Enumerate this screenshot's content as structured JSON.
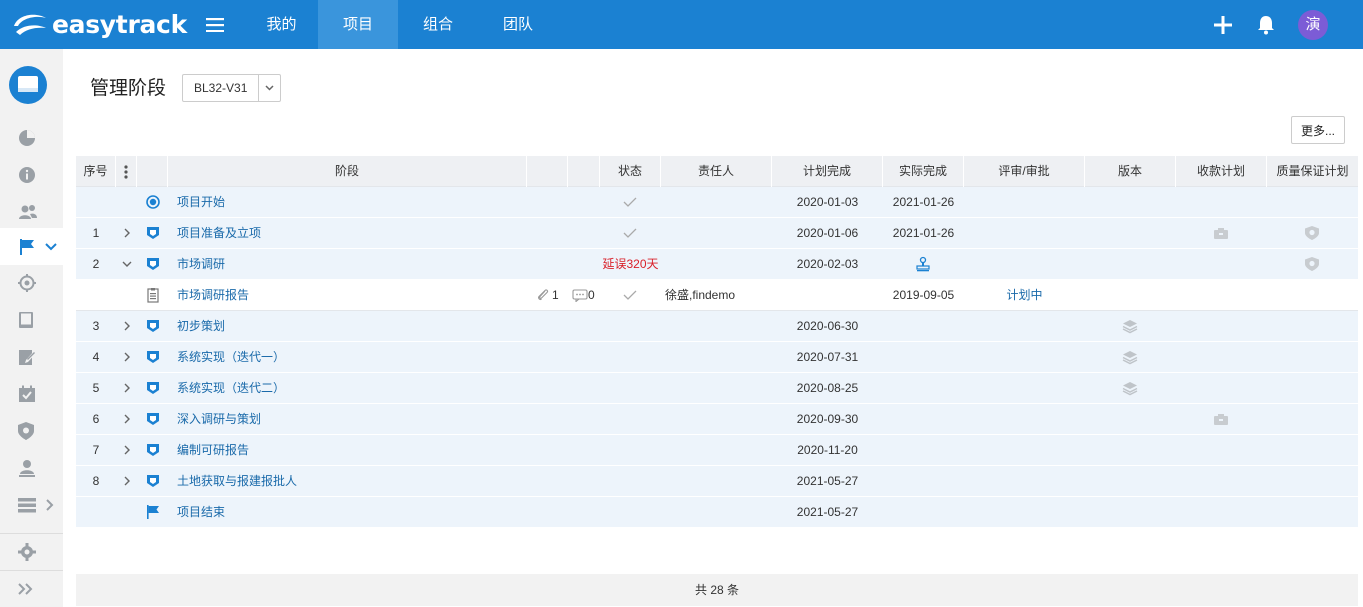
{
  "app": {
    "logo": "easytrack",
    "nav": [
      {
        "label": "我的"
      },
      {
        "label": "项目"
      },
      {
        "label": "组合"
      },
      {
        "label": "团队"
      }
    ],
    "avatar_text": "演",
    "accent": "#1b81d2"
  },
  "page": {
    "title": "管理阶段",
    "version": "BL32-V31",
    "more_label": "更多..."
  },
  "table": {
    "headers": {
      "seq": "序号",
      "stage": "阶段",
      "status": "状态",
      "owner": "责任人",
      "planned": "计划完成",
      "actual": "实际完成",
      "review": "评审/审批",
      "version": "版本",
      "payment": "收款计划",
      "qa": "质量保证计划"
    },
    "rows": [
      {
        "seq": "",
        "name": "项目开始",
        "status": "✓",
        "planned": "2020-01-03",
        "actual": "2021-01-26"
      },
      {
        "seq": "1",
        "name": "项目准备及立项",
        "status": "✓",
        "planned": "2020-01-06",
        "actual": "2021-01-26"
      },
      {
        "seq": "2",
        "name": "市场调研",
        "status": "延误320天",
        "planned": "2020-02-03",
        "actual": ""
      },
      {
        "seq": "",
        "name": "市场调研报告",
        "attachments": "1",
        "comments": "0",
        "status": "✓",
        "owner": "徐盛,findemo",
        "planned": "",
        "actual": "2019-09-05",
        "review": "计划中"
      },
      {
        "seq": "3",
        "name": "初步策划",
        "status": "",
        "planned": "2020-06-30",
        "actual": ""
      },
      {
        "seq": "4",
        "name": "系统实现（迭代一）",
        "status": "",
        "planned": "2020-07-31",
        "actual": ""
      },
      {
        "seq": "5",
        "name": "系统实现（迭代二）",
        "status": "",
        "planned": "2020-08-25",
        "actual": ""
      },
      {
        "seq": "6",
        "name": "深入调研与策划",
        "status": "",
        "planned": "2020-09-30",
        "actual": ""
      },
      {
        "seq": "7",
        "name": "编制可研报告",
        "status": "",
        "planned": "2020-11-20",
        "actual": ""
      },
      {
        "seq": "8",
        "name": "土地获取与报建报批人",
        "status": "",
        "planned": "2021-05-27",
        "actual": ""
      },
      {
        "seq": "",
        "name": "项目结束",
        "status": "",
        "planned": "2021-05-27",
        "actual": ""
      }
    ]
  },
  "footer": {
    "total": "共 28 条"
  }
}
